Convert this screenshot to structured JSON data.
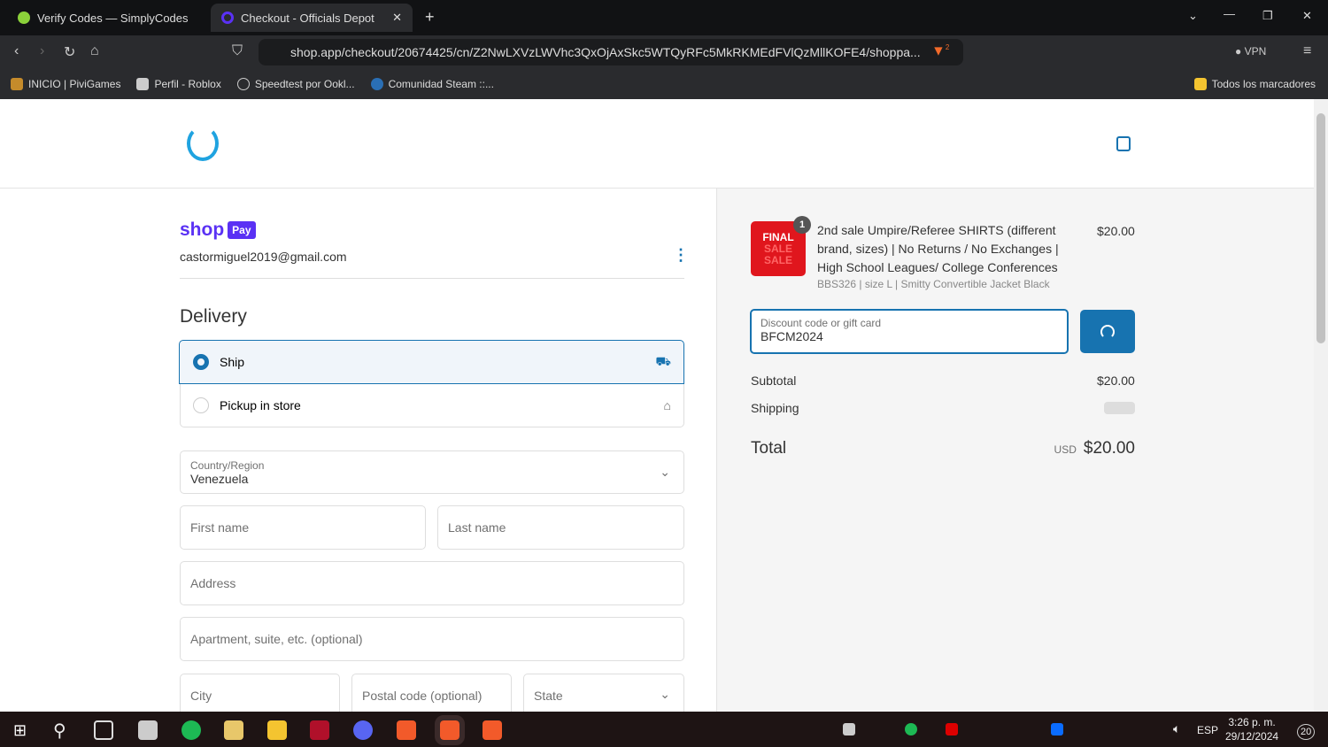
{
  "browser": {
    "tabs": [
      {
        "title": "Verify Codes — SimplyCodes"
      },
      {
        "title": "Checkout - Officials Depot"
      }
    ],
    "url": "shop.app/checkout/20674425/cn/Z2NwLXVzLWVhc3QxOjAxSkc5WTQyRFc5MkRKMEdFVlQzMllKOFE4/shoppa...",
    "vpn_label": "VPN",
    "shields_count": "2",
    "bookmarks": [
      "INICIO | PiviGames",
      "Perfil - Roblox",
      "Speedtest por Ookl...",
      "Comunidad Steam ::..."
    ],
    "all_bookmarks": "Todos los marcadores"
  },
  "checkout": {
    "shop_pay": {
      "shop": "shop",
      "pay": "Pay"
    },
    "email": "castormiguel2019@gmail.com",
    "delivery_title": "Delivery",
    "options": [
      {
        "label": "Ship",
        "selected": true
      },
      {
        "label": "Pickup in store",
        "selected": false
      }
    ],
    "country_label": "Country/Region",
    "country_value": "Venezuela",
    "placeholders": {
      "first_name": "First name",
      "last_name": "Last name",
      "address": "Address",
      "apartment": "Apartment, suite, etc. (optional)",
      "city": "City",
      "postal": "Postal code (optional)",
      "state": "State"
    }
  },
  "summary": {
    "item": {
      "qty": "1",
      "thumb": [
        "FINAL",
        "SALE",
        "SALE"
      ],
      "title": "2nd sale Umpire/Referee SHIRTS (different brand, sizes) | No Returns / No Exchanges | High School Leagues/ College Conferences",
      "variant": "BBS326 | size L | Smitty Convertible Jacket Black",
      "price": "$20.00"
    },
    "discount_label": "Discount code or gift card",
    "discount_value": "BFCM2024",
    "subtotal_label": "Subtotal",
    "subtotal": "$20.00",
    "shipping_label": "Shipping",
    "total_label": "Total",
    "currency": "USD",
    "total": "$20.00"
  },
  "taskbar": {
    "lang": "ESP",
    "time": "3:26 p. m.",
    "date": "29/12/2024",
    "notifications": "20"
  },
  "colors": {
    "accent": "#1773b0",
    "shop_pay": "#5a31f4"
  }
}
